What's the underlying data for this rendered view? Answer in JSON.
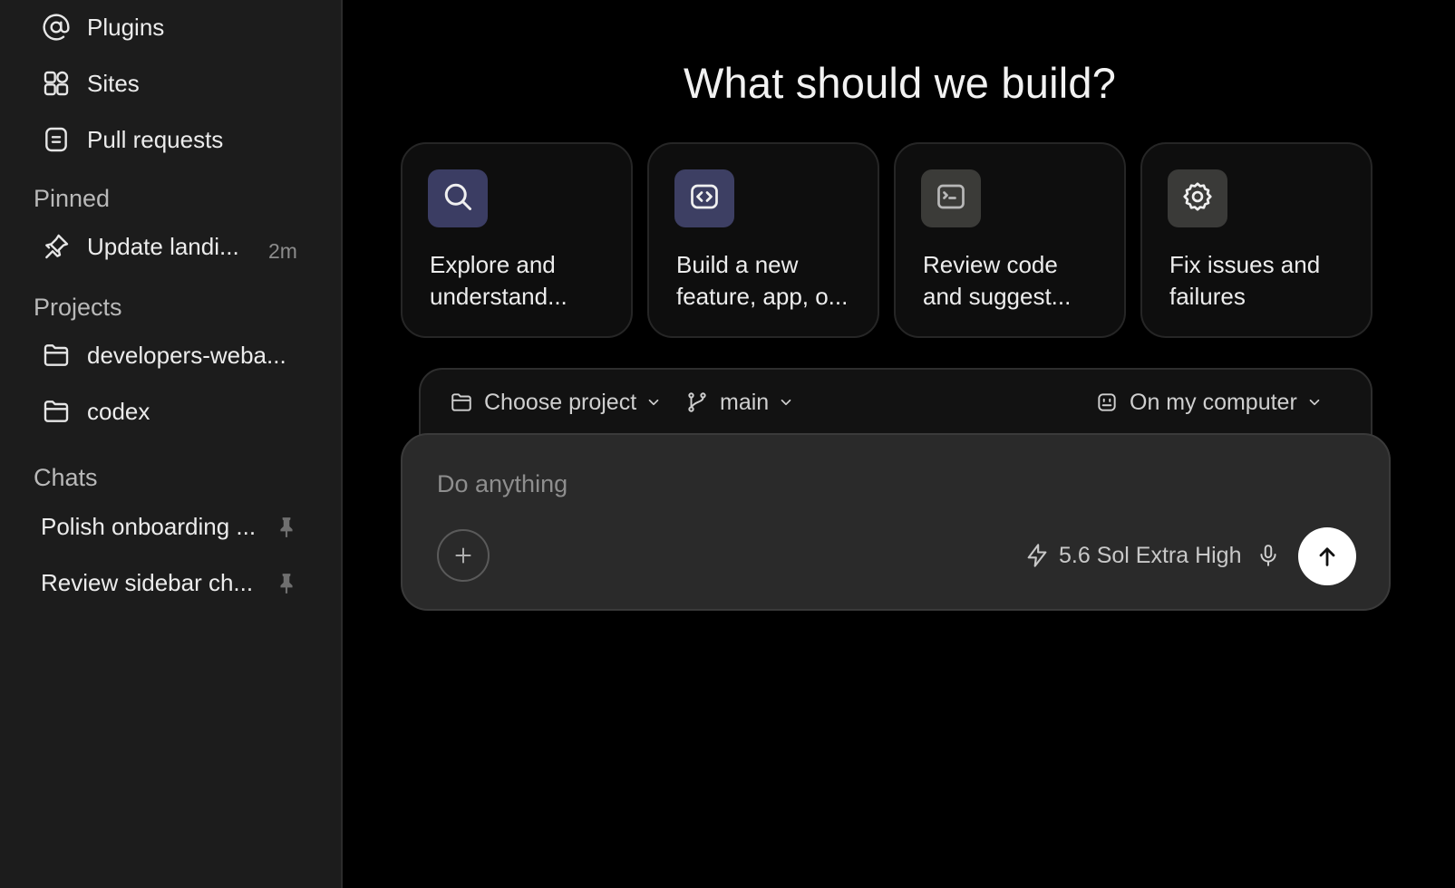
{
  "sidebar": {
    "nav": [
      {
        "label": "Plugins",
        "icon": "at-sign-icon"
      },
      {
        "label": "Sites",
        "icon": "sites-grid-icon"
      },
      {
        "label": "Pull requests",
        "icon": "pull-request-icon"
      }
    ],
    "pinned": {
      "title": "Pinned",
      "items": [
        {
          "label": "Update landi...",
          "time": "2m",
          "icon": "pin-icon"
        }
      ]
    },
    "projects": {
      "title": "Projects",
      "items": [
        {
          "label": "developers-weba...",
          "icon": "folder-icon"
        },
        {
          "label": "codex",
          "icon": "folder-icon"
        }
      ]
    },
    "chats": {
      "title": "Chats",
      "items": [
        {
          "label": "Polish onboarding ...",
          "icon": "pin-icon"
        },
        {
          "label": "Review sidebar ch...",
          "icon": "pin-icon"
        }
      ]
    }
  },
  "main": {
    "headline": "What should we build?",
    "cards": [
      {
        "line1": "Explore and",
        "line2": "understand...",
        "icon": "search-icon",
        "badge_color": "#3b3d63"
      },
      {
        "line1": "Build a new",
        "line2": "feature, app, o...",
        "icon": "code-icon",
        "badge_color": "#3d3f63"
      },
      {
        "line1": "Review code",
        "line2": "and suggest...",
        "icon": "terminal-icon",
        "badge_color": "#3b3b38"
      },
      {
        "line1": "Fix issues and",
        "line2": "failures",
        "icon": "gear-icon",
        "badge_color": "#3a3a38"
      }
    ],
    "selectors": {
      "project": "Choose project",
      "branch": "main",
      "environment": "On my computer"
    },
    "composer": {
      "placeholder": "Do anything",
      "model": "5.6 Sol Extra High"
    }
  }
}
